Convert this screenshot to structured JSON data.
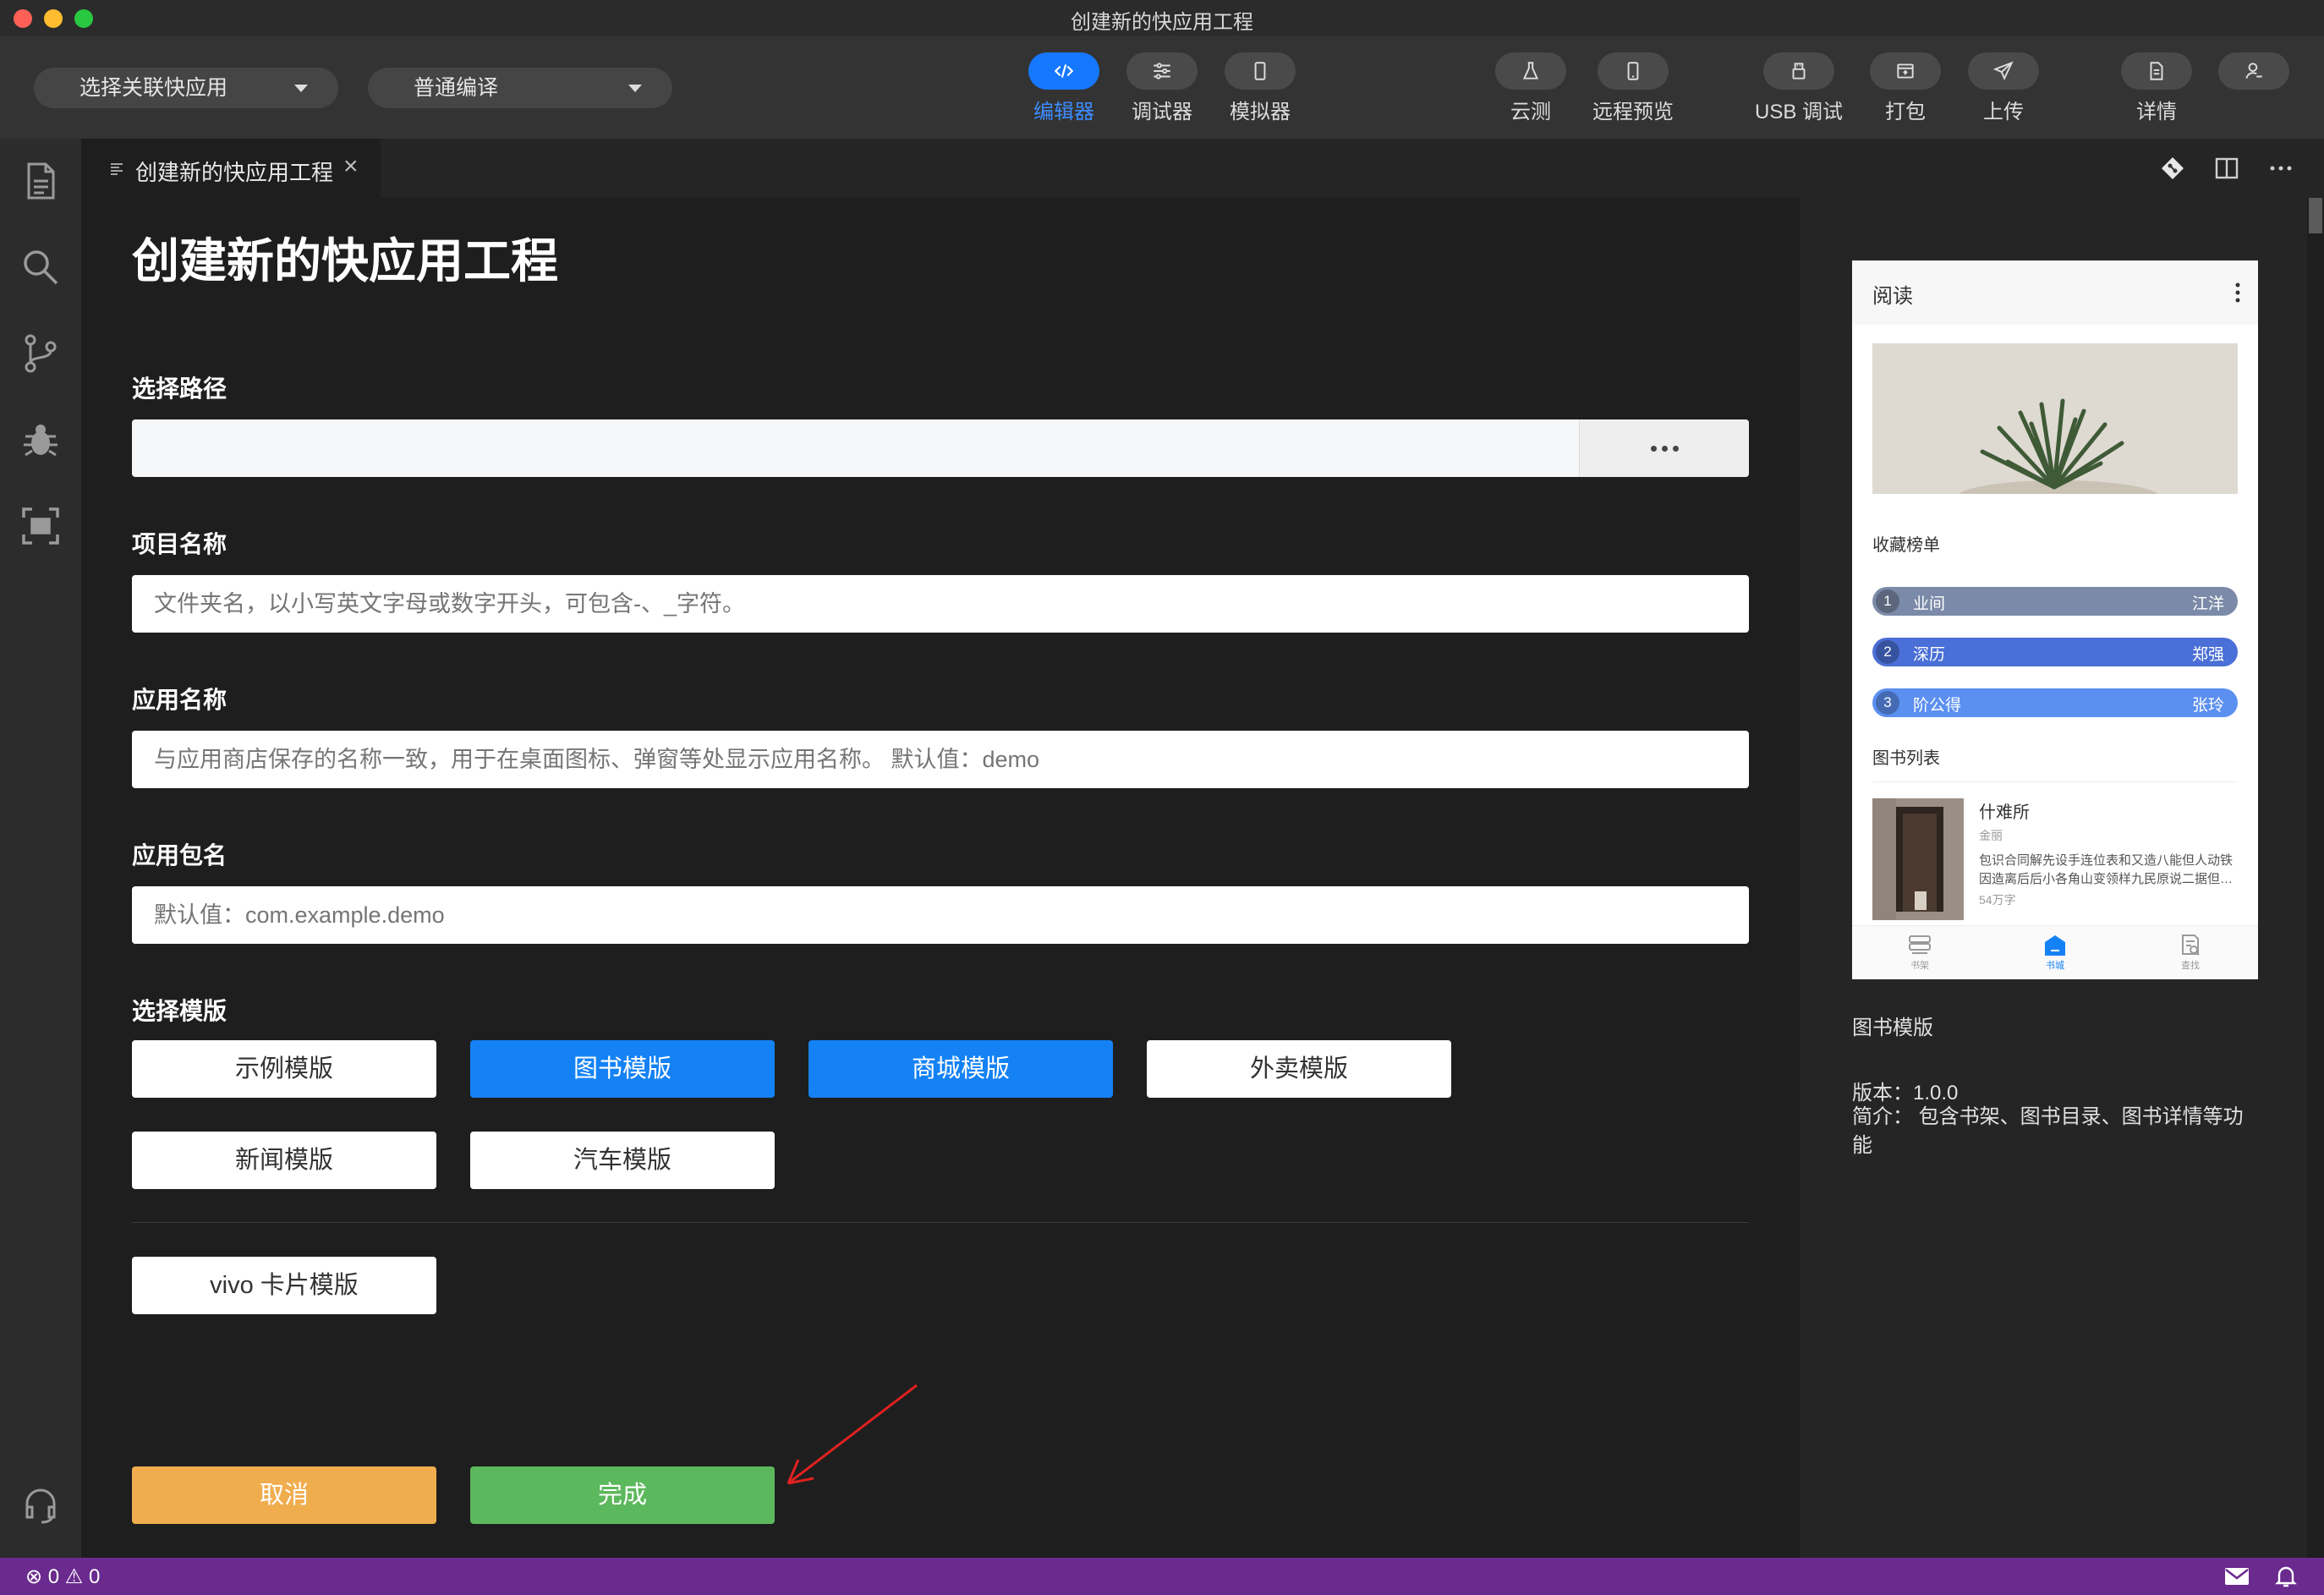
{
  "window": {
    "title": "创建新的快应用工程"
  },
  "toolbar": {
    "app_select": "选择关联快应用",
    "compile_select": "普通编译",
    "tools": [
      {
        "label": "编辑器",
        "icon": "code-icon",
        "active": true
      },
      {
        "label": "调试器",
        "icon": "sliders-icon",
        "active": false
      },
      {
        "label": "模拟器",
        "icon": "phone-icon",
        "active": false
      },
      {
        "label": "云测",
        "icon": "flask-icon",
        "active": false
      },
      {
        "label": "远程预览",
        "icon": "mobile-icon",
        "active": false
      },
      {
        "label": "USB 调试",
        "icon": "usb-icon",
        "active": false
      },
      {
        "label": "打包",
        "icon": "package-icon",
        "active": false
      },
      {
        "label": "上传",
        "icon": "send-icon",
        "active": false
      },
      {
        "label": "详情",
        "icon": "document-icon",
        "active": false
      },
      {
        "label": "",
        "icon": "user-icon",
        "active": false
      }
    ]
  },
  "tab": {
    "label": "创建新的快应用工程",
    "close": "×"
  },
  "form": {
    "title": "创建新的快应用工程",
    "path_label": "选择路径",
    "path_value": "",
    "project_label": "项目名称",
    "project_placeholder": "文件夹名，以小写英文字母或数字开头，可包含-、_字符。",
    "app_label": "应用名称",
    "app_placeholder": "与应用商店保存的名称一致，用于在桌面图标、弹窗等处显示应用名称。 默认值：demo",
    "package_label": "应用包名",
    "package_placeholder": "默认值：com.example.demo",
    "template_label": "选择模版",
    "templates": [
      "示例模版",
      "图书模版",
      "商城模版",
      "外卖模版",
      "新闻模版",
      "汽车模版"
    ],
    "card_template": "vivo 卡片模版",
    "cancel": "取消",
    "done": "完成"
  },
  "preview": {
    "phone": {
      "header": "阅读",
      "ranking_title": "收藏榜单",
      "ranking": [
        {
          "num": "1",
          "name": "业间",
          "author": "江洋"
        },
        {
          "num": "2",
          "name": "深历",
          "author": "郑强"
        },
        {
          "num": "3",
          "name": "阶公得",
          "author": "张玲"
        }
      ],
      "list_title": "图书列表",
      "book": {
        "title": "什难所",
        "author": "金丽",
        "desc1": "包识合同解先设手连位表和又造八能但人动铁",
        "desc2": "因造离后后小各角山变领样九民原说二据但…",
        "words": "54万字"
      },
      "nav": [
        "书架",
        "书城",
        "查找"
      ]
    },
    "template_name": "图书模版",
    "version": "版本：1.0.0",
    "description": "简介： 包含书架、图书目录、图书详情等功能"
  },
  "status": {
    "text": "⊗ 0 ⚠ 0"
  },
  "colors": {
    "accent": "#1677ff",
    "selected_template": "#1482f5",
    "cancel": "#f0ad4e",
    "done": "#5cb85c",
    "statusbar": "#6a2a8e",
    "rank1": "#7b8aa8",
    "rank2": "#4a6fd6",
    "rank3": "#5b8ff0"
  }
}
